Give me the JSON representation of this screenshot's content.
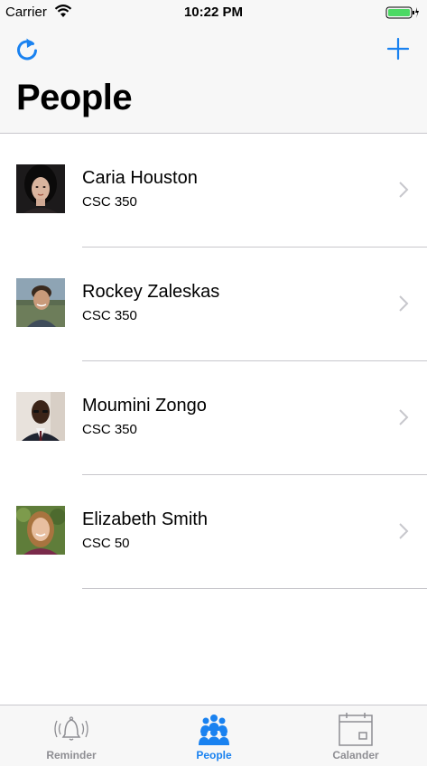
{
  "status_bar": {
    "carrier": "Carrier",
    "time": "10:22 PM"
  },
  "nav": {
    "title": "People",
    "refresh_icon": "refresh-icon",
    "add_icon": "plus-icon"
  },
  "colors": {
    "accent": "#1a82f0",
    "inactive": "#8e8e93",
    "bar_bg": "#f7f7f7",
    "separator": "#c8c7cc",
    "battery": "#4cd964"
  },
  "people": [
    {
      "name": "Caria Houston",
      "course": "CSC 350"
    },
    {
      "name": "Rockey Zaleskas",
      "course": "CSC 350"
    },
    {
      "name": "Moumini Zongo",
      "course": "CSC 350"
    },
    {
      "name": "Elizabeth Smith",
      "course": "CSC 50"
    }
  ],
  "tabs": [
    {
      "label": "Reminder",
      "icon": "bell-icon",
      "active": false
    },
    {
      "label": "People",
      "icon": "people-icon",
      "active": true
    },
    {
      "label": "Calander",
      "icon": "calendar-icon",
      "active": false
    }
  ]
}
